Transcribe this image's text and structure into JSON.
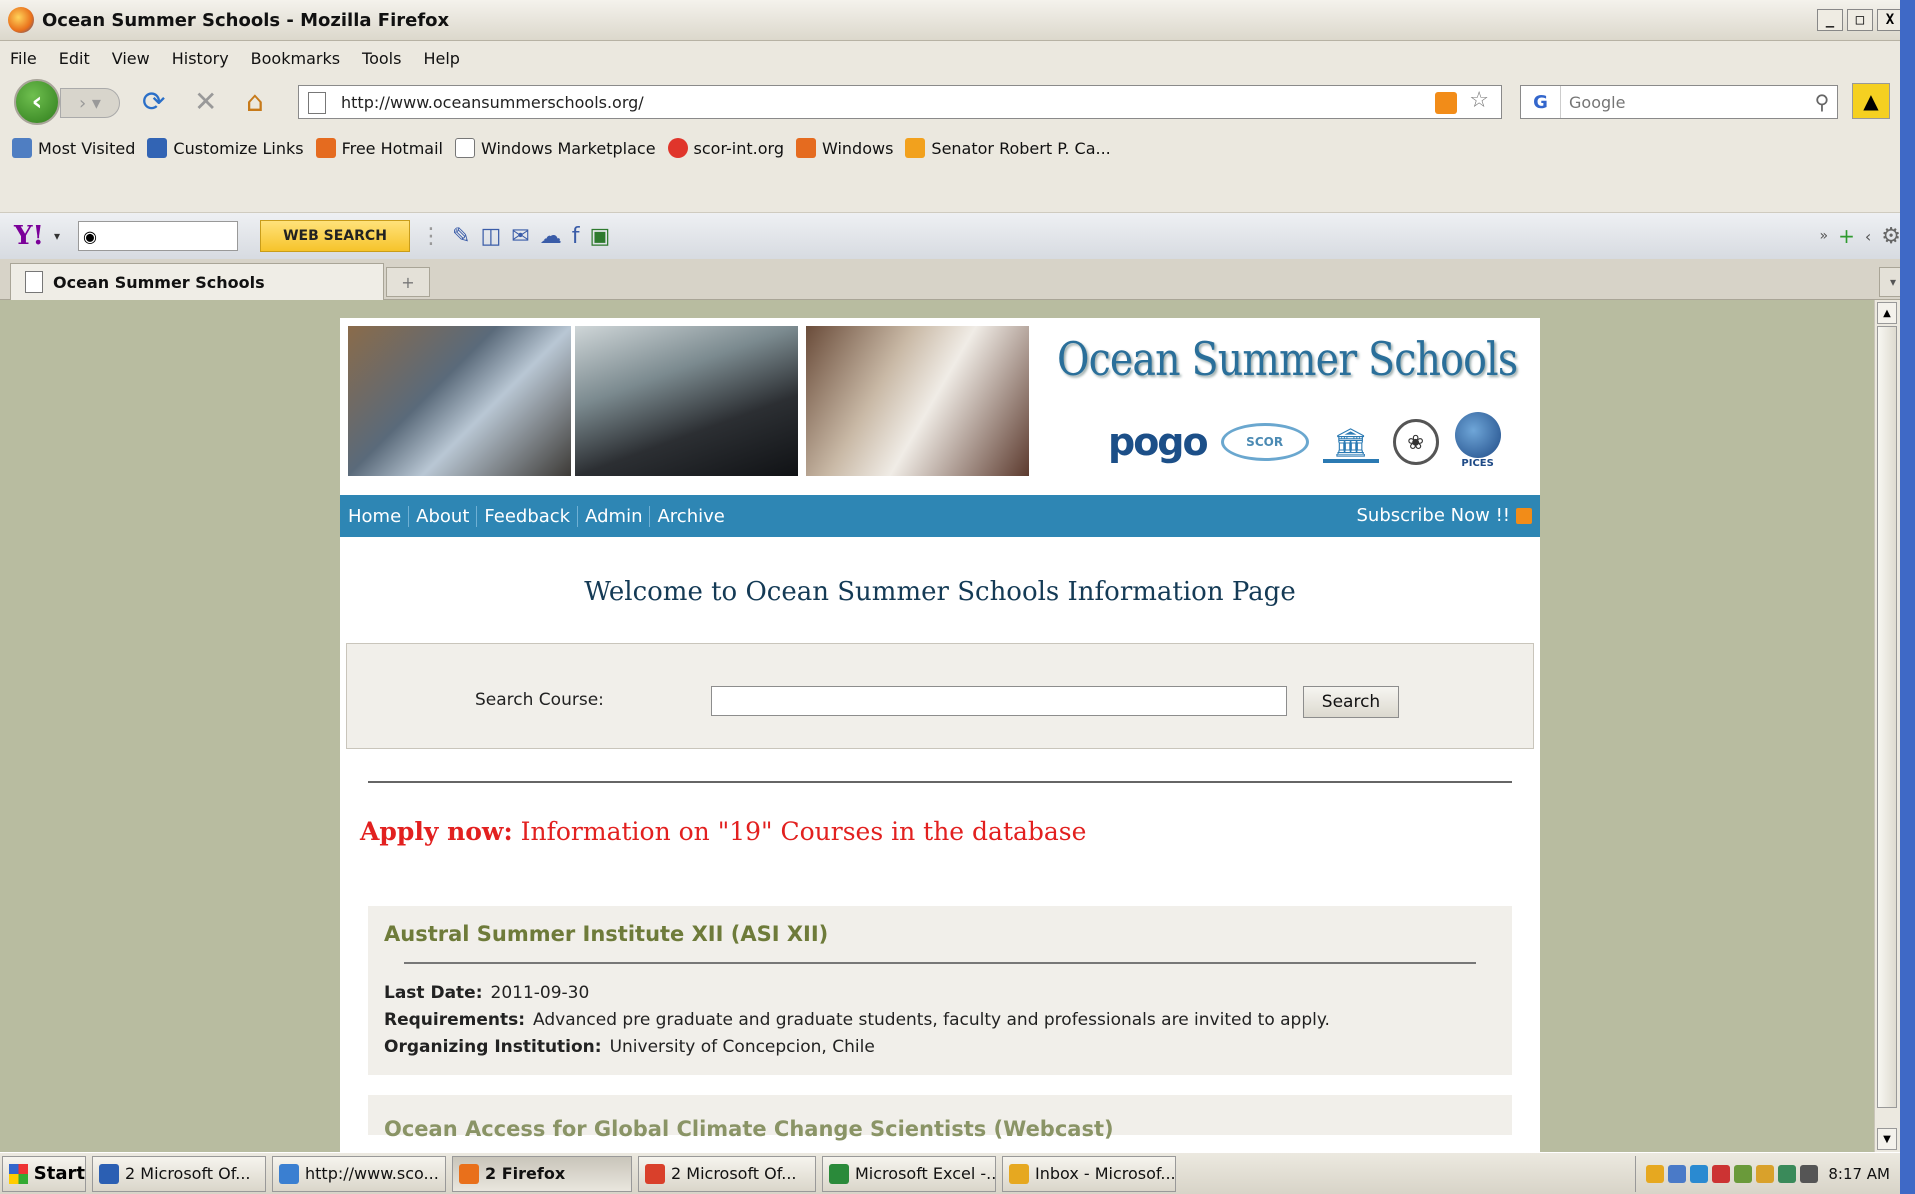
{
  "window": {
    "title": "Ocean Summer Schools - Mozilla Firefox",
    "controls": [
      "_",
      "□",
      "X"
    ]
  },
  "menu": [
    "File",
    "Edit",
    "View",
    "History",
    "Bookmarks",
    "Tools",
    "Help"
  ],
  "navbar": {
    "url": "http://www.oceansummerschools.org/",
    "search_placeholder": "Google"
  },
  "bookmarks": [
    {
      "label": "Most Visited",
      "icon": "most-visited-icon",
      "color": "#4f7ec2"
    },
    {
      "label": "Customize Links",
      "icon": "msn-icon",
      "color": "#3264b4"
    },
    {
      "label": "Free Hotmail",
      "icon": "windows-icon",
      "color": "#e56b1f"
    },
    {
      "label": "Windows Marketplace",
      "icon": "page-icon",
      "color": "#ffffff"
    },
    {
      "label": "scor-int.org",
      "icon": "scor-icon",
      "color": "#e0352b"
    },
    {
      "label": "Windows",
      "icon": "windows-icon",
      "color": "#e56b1f"
    },
    {
      "label": "Senator Robert P. Ca...",
      "icon": "rss-icon",
      "color": "#f2a11d"
    }
  ],
  "yahoo": {
    "logo": "Y!",
    "web_search_label": "WEB SEARCH"
  },
  "tab": {
    "label": "Ocean Summer Schools"
  },
  "site": {
    "title": "Ocean Summer Schools",
    "logos": {
      "pogo": "pogo",
      "scor": "SCOR",
      "pices": "PICES"
    },
    "nav": [
      "Home",
      "About",
      "Feedback",
      "Admin",
      "Archive"
    ],
    "subscribe": "Subscribe Now !!",
    "welcome": "Welcome to Ocean Summer Schools Information Page",
    "search_label": "Search Course:",
    "search_button": "Search",
    "search_value": "",
    "apply_bold": "Apply now:",
    "apply_text": "Information on \"19\" Courses in the database"
  },
  "course": {
    "title": "Austral Summer Institute XII (ASI XII)",
    "last_date_label": "Last Date:",
    "last_date": "2011-09-30",
    "requirements_label": "Requirements:",
    "requirements": "Advanced pre graduate and graduate students, faculty and professionals are invited to apply.",
    "institution_label": "Organizing Institution:",
    "institution": "University of Concepcion, Chile"
  },
  "course2_partial": "Ocean Access for Global Climate Change Scientists (Webcast)",
  "taskbar": {
    "start": "Start",
    "tasks": [
      {
        "label": "2 Microsoft Of...",
        "color": "#2b5fb3",
        "active": false
      },
      {
        "label": "http://www.sco...",
        "color": "#3a7fd1",
        "active": false
      },
      {
        "label": "2 Firefox",
        "color": "#e9701b",
        "active": true
      },
      {
        "label": "2 Microsoft Of...",
        "color": "#d9402b",
        "active": false
      },
      {
        "label": "Microsoft Excel -...",
        "color": "#2a8a3a",
        "active": false
      },
      {
        "label": "Inbox - Microsof...",
        "color": "#e6a820",
        "active": false
      }
    ],
    "clock": "8:17 AM"
  }
}
